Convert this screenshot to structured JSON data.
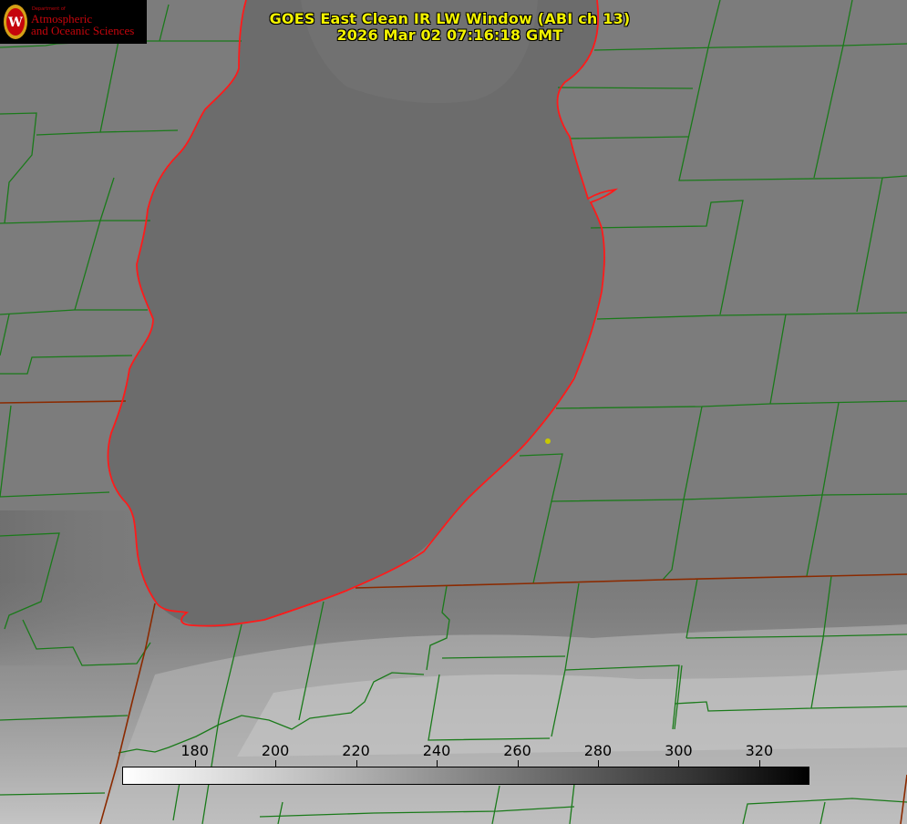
{
  "title": {
    "line1": "GOES East Clean IR LW Window (ABI ch 13)",
    "line2": "2026 Mar 02 07:16:18 GMT"
  },
  "logo": {
    "department": "Department of",
    "line1": "Atmospheric",
    "line2": "and Oceanic Sciences",
    "seal_letter": "W"
  },
  "colorbar": {
    "ticks": [
      {
        "label": "180",
        "value": 180
      },
      {
        "label": "200",
        "value": 200
      },
      {
        "label": "220",
        "value": 220
      },
      {
        "label": "240",
        "value": 240
      },
      {
        "label": "260",
        "value": 260
      },
      {
        "label": "280",
        "value": 280
      },
      {
        "label": "300",
        "value": 300
      },
      {
        "label": "320",
        "value": 320
      }
    ],
    "range": [
      162,
      332
    ],
    "gradient": "white-to-black"
  },
  "colors": {
    "title": "#f2f200",
    "county_lines": "#1a7a1a",
    "state_line": "#8b2a00",
    "shoreline": "#ff1a1a",
    "marker": "#c8c800",
    "logo_red": "#c5050c"
  }
}
